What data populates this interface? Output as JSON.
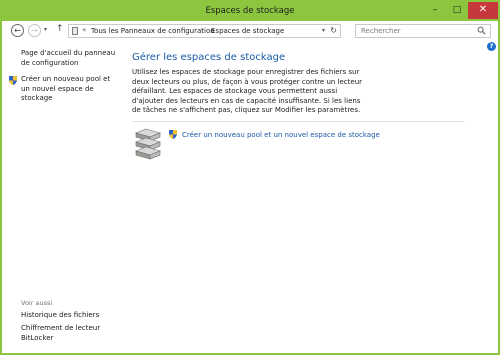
{
  "window": {
    "title": "Espaces de stockage",
    "controls": {
      "minimize": "–",
      "maximize": "□",
      "close": "✕"
    },
    "accent_color": "#8cc63f"
  },
  "navigation": {
    "back_glyph": "←",
    "forward_glyph": "→",
    "recent_glyph": "▾",
    "up_glyph": "↑"
  },
  "address_bar": {
    "prefix_glyph": "«",
    "crumbs": [
      "Tous les Panneaux de configuration",
      "Espaces de stockage"
    ],
    "separator": "›",
    "dropdown_glyph": "▾",
    "refresh_glyph": "↻"
  },
  "search": {
    "placeholder": "Rechercher"
  },
  "help": {
    "glyph": "?"
  },
  "sidebar": {
    "home_link": "Page d'accueil du panneau de configuration",
    "create_link": "Créer un nouveau pool et un nouvel espace de stockage",
    "see_also_heading": "Voir aussi",
    "see_also_links": [
      "Historique des fichiers",
      "Chiffrement de lecteur BitLocker"
    ]
  },
  "main": {
    "title": "Gérer les espaces de stockage",
    "description": "Utilisez les espaces de stockage pour enregistrer des fichiers sur deux lecteurs ou plus, de façon à vous protéger contre un lecteur défaillant. Les espaces de stockage vous permettent aussi d'ajouter des lecteurs en cas de capacité insuffisante. Si les liens de tâches ne s'affichent pas, cliquez sur Modifier les paramètres.",
    "create_link": "Créer un nouveau pool et un nouvel espace de stockage",
    "link_color": "#1a5aa8"
  },
  "icons": [
    "shield-icon",
    "storage-drives-icon",
    "search-icon",
    "help-icon",
    "control-panel-icon"
  ]
}
